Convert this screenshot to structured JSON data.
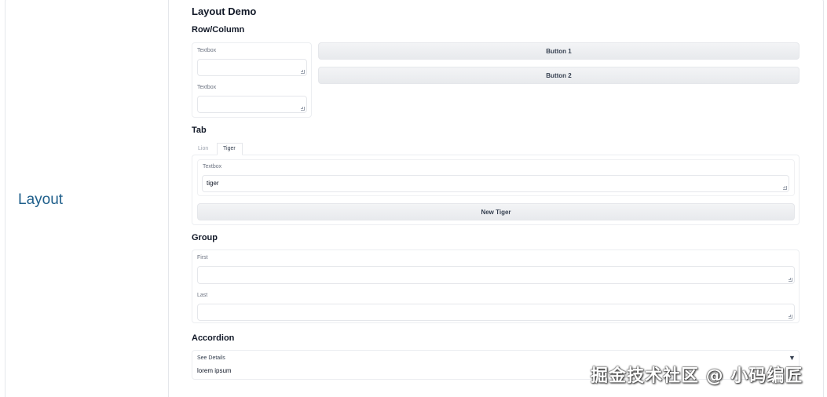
{
  "sidebar": {
    "label": "Layout"
  },
  "demo": {
    "title": "Layout Demo",
    "row_column": {
      "heading": "Row/Column",
      "textbox1_label": "Textbox",
      "textbox2_label": "Textbox",
      "button1": "Button 1",
      "button2": "Button 2"
    },
    "tab": {
      "heading": "Tab",
      "tabs": [
        "Lion",
        "Tiger"
      ],
      "selected": "Tiger",
      "textbox_label": "Textbox",
      "textbox_value": "tiger",
      "button": "New Tiger"
    },
    "group": {
      "heading": "Group",
      "first_label": "First",
      "last_label": "Last"
    },
    "accordion": {
      "heading": "Accordion",
      "summary": "See Details",
      "caret": "▼",
      "content": "lorem ipsum"
    }
  },
  "watermark": "掘金技术社区 @ 小码编匠"
}
